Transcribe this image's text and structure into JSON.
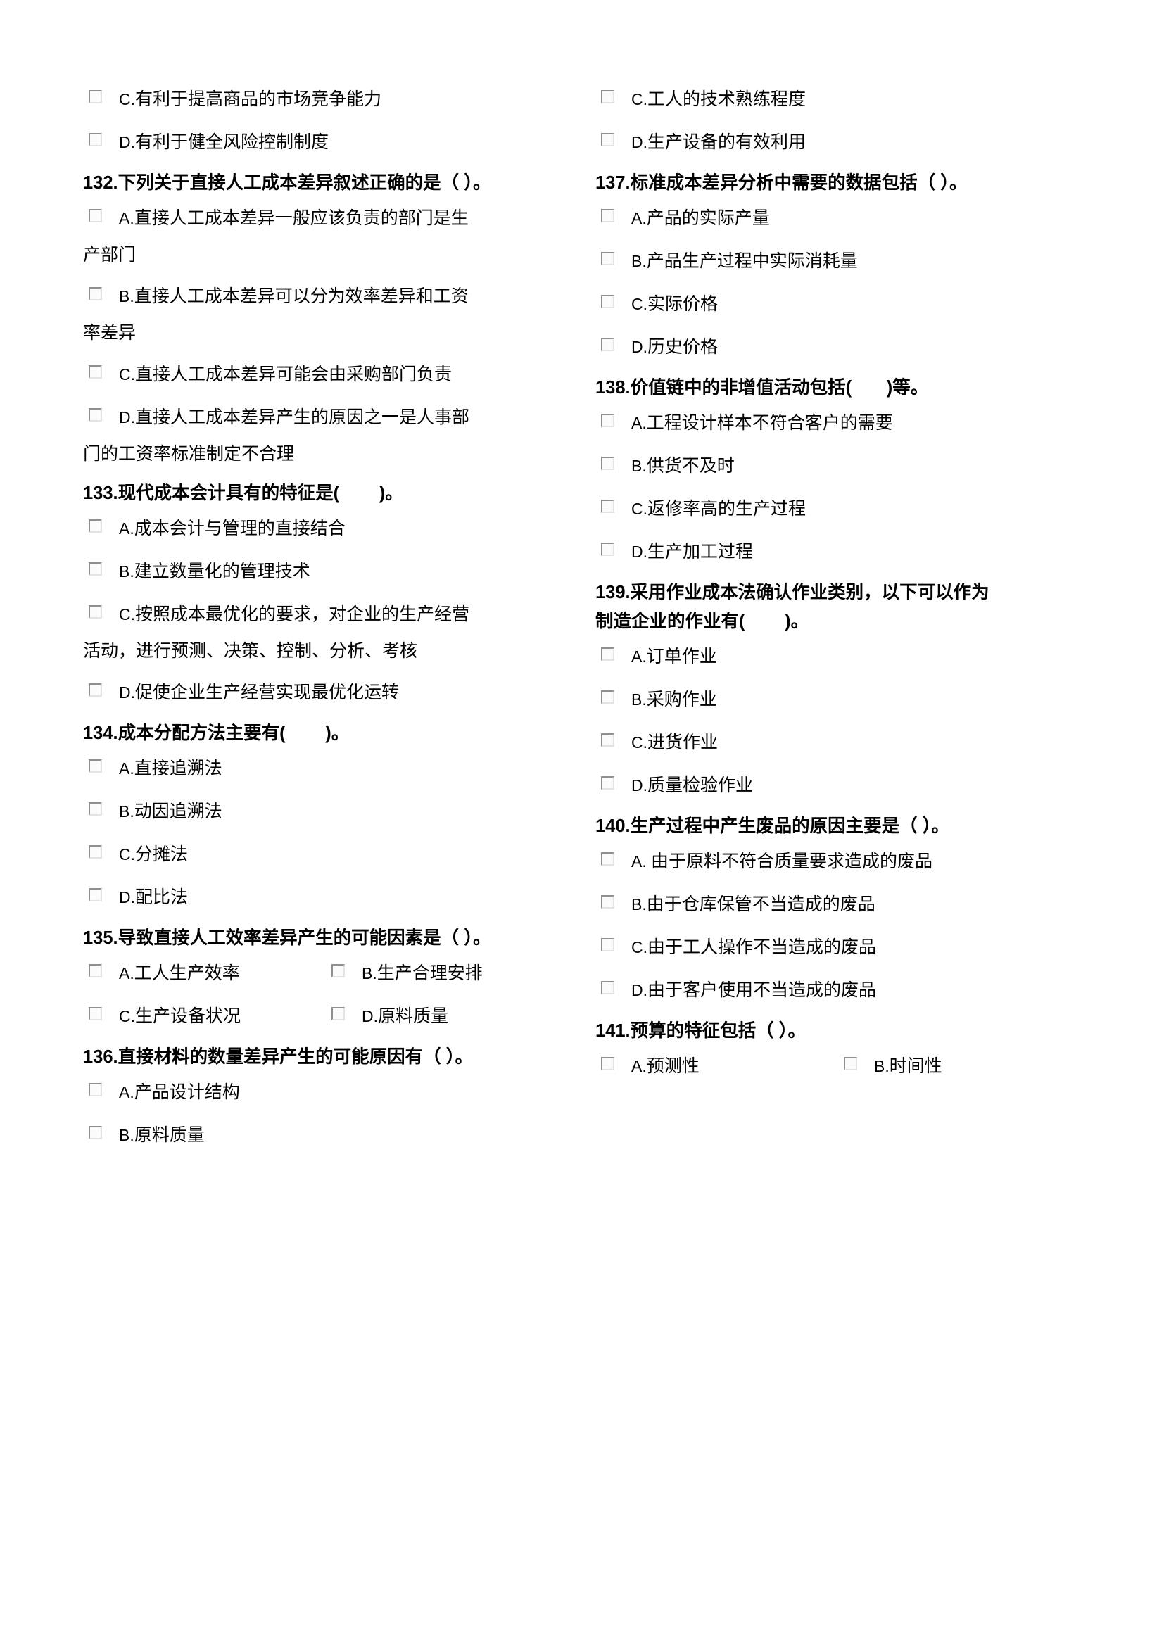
{
  "document": {
    "type": "multiple-choice-exam-page",
    "language": "zh-CN",
    "checkbox_glyph": "empty-square",
    "checkbox_color": "#8f8f8f"
  },
  "left_column": {
    "leading_options": [
      {
        "label": "C.",
        "text": "有利于提高商品的市场竞争能力"
      },
      {
        "label": "D.",
        "text": "有利于健全风险控制制度"
      }
    ],
    "questions": [
      {
        "number": "132.",
        "stem": "下列关于直接人工成本差异叙述正确的是（ ）。",
        "options": [
          {
            "label": "A.",
            "text": "直接人工成本差异一般应该负责的部门是生",
            "continuation": "产部门"
          },
          {
            "label": "B.",
            "text": "直接人工成本差异可以分为效率差异和工资",
            "continuation": "率差异"
          },
          {
            "label": "C.",
            "text": "直接人工成本差异可能会由采购部门负责",
            "continuation": ""
          },
          {
            "label": "D.",
            "text": "直接人工成本差异产生的原因之一是人事部",
            "continuation": "门的工资率标准制定不合理"
          }
        ]
      },
      {
        "number": "133.",
        "stem": "现代成本会计具有的特征是(        )。",
        "options": [
          {
            "label": "A.",
            "text": "成本会计与管理的直接结合",
            "continuation": ""
          },
          {
            "label": "B.",
            "text": "建立数量化的管理技术",
            "continuation": ""
          },
          {
            "label": "C.",
            "text": "按照成本最优化的要求，对企业的生产经营",
            "continuation": "活动，进行预测、决策、控制、分析、考核"
          },
          {
            "label": "D.",
            "text": "促使企业生产经营实现最优化运转",
            "continuation": ""
          }
        ]
      },
      {
        "number": "134.",
        "stem": "成本分配方法主要有(        )。",
        "options": [
          {
            "label": "A.",
            "text": "直接追溯法",
            "continuation": ""
          },
          {
            "label": "B.",
            "text": "动因追溯法",
            "continuation": ""
          },
          {
            "label": "C.",
            "text": "分摊法",
            "continuation": ""
          },
          {
            "label": "D.",
            "text": "配比法",
            "continuation": ""
          }
        ]
      },
      {
        "number": "135.",
        "stem": "导致直接人工效率差异产生的可能因素是（ ）。",
        "two_column_options": [
          [
            {
              "label": "A.",
              "text": "工人生产效率"
            },
            {
              "label": "B.",
              "text": "生产合理安排"
            }
          ],
          [
            {
              "label": "C.",
              "text": "生产设备状况"
            },
            {
              "label": "D.",
              "text": "原料质量"
            }
          ]
        ]
      },
      {
        "number": "136.",
        "stem": "直接材料的数量差异产生的可能原因有（ ）。",
        "options": [
          {
            "label": "A.",
            "text": "产品设计结构",
            "continuation": ""
          },
          {
            "label": "B.",
            "text": "原料质量",
            "continuation": ""
          }
        ]
      }
    ]
  },
  "right_column": {
    "leading_options": [
      {
        "label": "C.",
        "text": "工人的技术熟练程度"
      },
      {
        "label": "D.",
        "text": "生产设备的有效利用"
      }
    ],
    "questions": [
      {
        "number": "137.",
        "stem": "标准成本差异分析中需要的数据包括（ ）。",
        "options": [
          {
            "label": "A.",
            "text": "产品的实际产量",
            "continuation": ""
          },
          {
            "label": "B.",
            "text": "产品生产过程中实际消耗量",
            "continuation": ""
          },
          {
            "label": "C.",
            "text": "实际价格",
            "continuation": ""
          },
          {
            "label": "D.",
            "text": "历史价格",
            "continuation": ""
          }
        ]
      },
      {
        "number": "138.",
        "stem": "价值链中的非增值活动包括(       )等。",
        "options": [
          {
            "label": "A.",
            "text": "工程设计样本不符合客户的需要",
            "continuation": ""
          },
          {
            "label": "B.",
            "text": "供货不及时",
            "continuation": ""
          },
          {
            "label": "C.",
            "text": "返修率高的生产过程",
            "continuation": ""
          },
          {
            "label": "D.",
            "text": "生产加工过程",
            "continuation": ""
          }
        ]
      },
      {
        "number": "139.",
        "stem": "采用作业成本法确认作业类别，以下可以作为\n制造企业的作业有(        )。",
        "options": [
          {
            "label": "A.",
            "text": "订单作业",
            "continuation": ""
          },
          {
            "label": "B.",
            "text": "采购作业",
            "continuation": ""
          },
          {
            "label": "C.",
            "text": "进货作业",
            "continuation": ""
          },
          {
            "label": "D.",
            "text": "质量检验作业",
            "continuation": ""
          }
        ]
      },
      {
        "number": "140.",
        "stem": "生产过程中产生废品的原因主要是（ ）。",
        "options": [
          {
            "label": "A.",
            "text": " 由于原料不符合质量要求造成的废品",
            "continuation": ""
          },
          {
            "label": "B.",
            "text": "由于仓库保管不当造成的废品",
            "continuation": ""
          },
          {
            "label": "C.",
            "text": "由于工人操作不当造成的废品",
            "continuation": ""
          },
          {
            "label": "D.",
            "text": "由于客户使用不当造成的废品",
            "continuation": ""
          }
        ]
      },
      {
        "number": "141.",
        "stem": "预算的特征包括（ ）。",
        "two_column_options": [
          [
            {
              "label": "A.",
              "text": "预测性"
            },
            {
              "label": "B.",
              "text": "时间性"
            }
          ]
        ]
      }
    ]
  }
}
